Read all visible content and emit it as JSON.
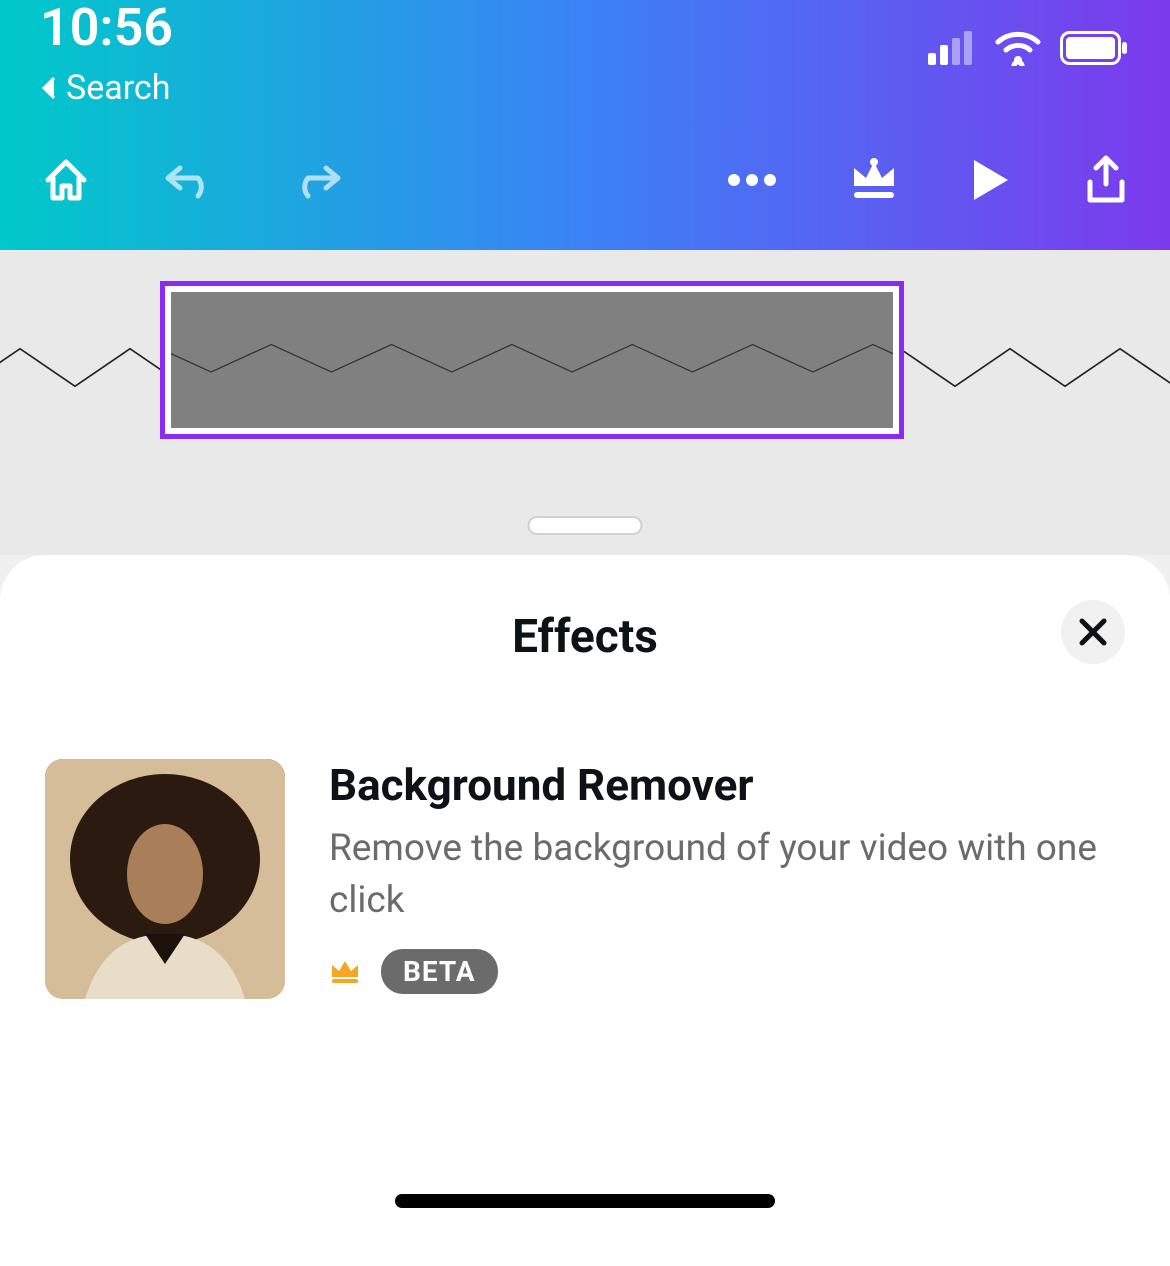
{
  "status": {
    "time": "10:56",
    "back_label": "Search"
  },
  "toolbar": {
    "icons": [
      "home",
      "undo",
      "redo",
      "more",
      "crown",
      "play",
      "export"
    ]
  },
  "panel": {
    "title": "Effects"
  },
  "effect": {
    "title": "Background Remover",
    "description": "Remove the background of your video with one click",
    "badge": "BETA"
  },
  "colors": {
    "selection_border": "#8b2cf5",
    "gradient_start": "#00c9c9",
    "gradient_mid": "#3b82f6",
    "gradient_end": "#7c3aed"
  }
}
